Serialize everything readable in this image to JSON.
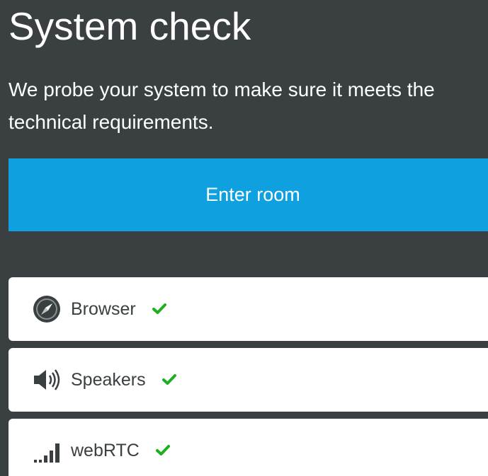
{
  "header": {
    "title": "System check",
    "subtitle": "We probe your system to make sure it meets the technical requirements."
  },
  "actions": {
    "enter_room_label": "Enter room"
  },
  "checks": [
    {
      "label": "Browser",
      "icon": "compass-icon",
      "status": "passed"
    },
    {
      "label": "Speakers",
      "icon": "speaker-icon",
      "status": "passed"
    },
    {
      "label": "webRTC",
      "icon": "signal-bars-icon",
      "status": "passed"
    }
  ],
  "colors": {
    "background": "#3a3f41",
    "accent": "#0fa0e0",
    "success": "#1fae1f",
    "card": "#ffffff"
  }
}
